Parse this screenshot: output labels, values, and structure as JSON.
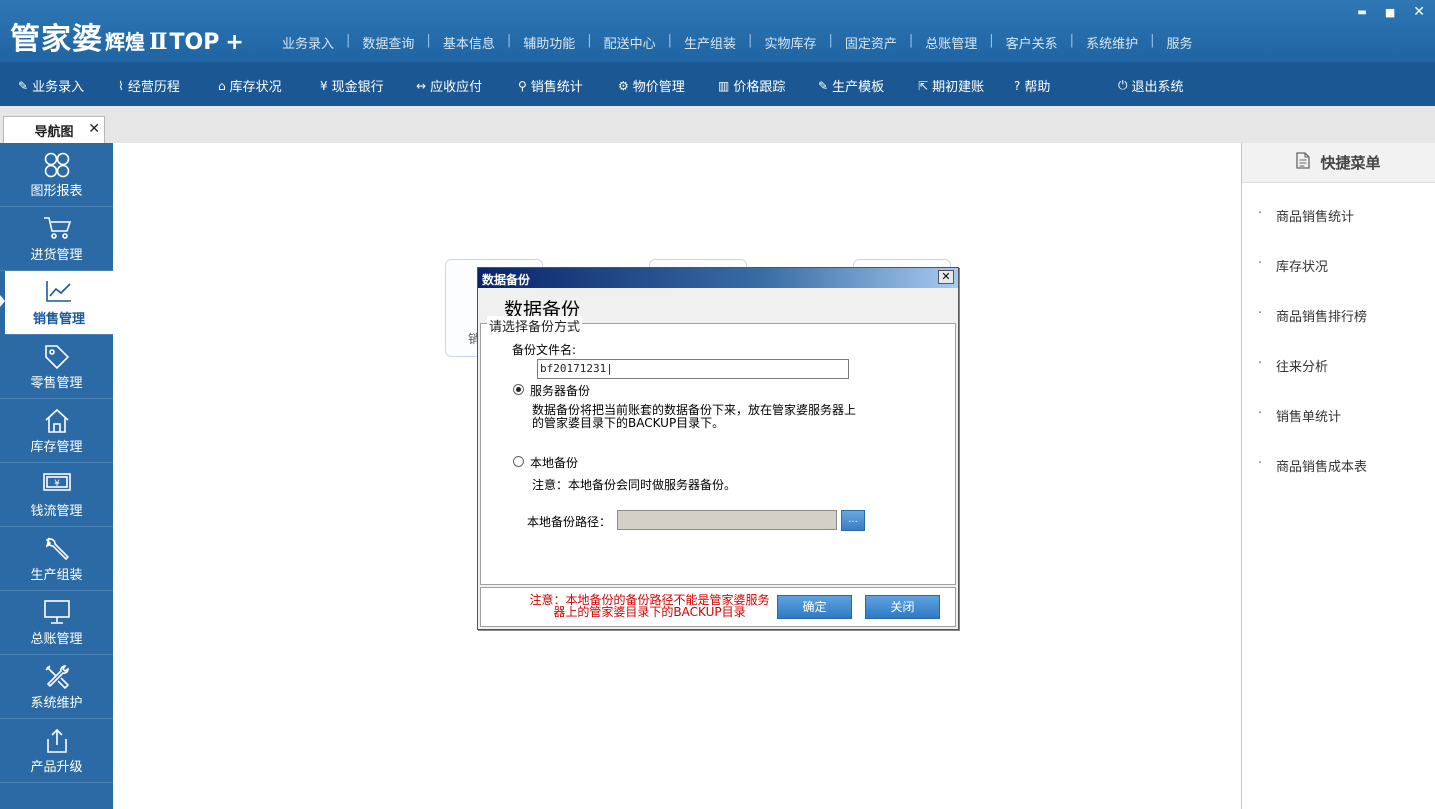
{
  "app": {
    "logo_main": "管家婆",
    "logo_sub": "辉煌",
    "logo_ver": "Ⅱ",
    "logo_top": "TOP",
    "logo_plus": "+"
  },
  "window_controls": {
    "minimize": "▬",
    "maximize": "■",
    "close": "✕"
  },
  "top_menu": [
    "业务录入",
    "数据查询",
    "基本信息",
    "辅助功能",
    "配送中心",
    "生产组装",
    "实物库存",
    "固定资产",
    "总账管理",
    "客户关系",
    "系统维护",
    "服务"
  ],
  "toolbar": [
    {
      "icon": "edit-icon",
      "glyph": "✎",
      "label": "业务录入"
    },
    {
      "icon": "chart-icon",
      "glyph": "⌇",
      "label": "经营历程"
    },
    {
      "icon": "home-icon",
      "glyph": "⌂",
      "label": "库存状况"
    },
    {
      "icon": "yen-icon",
      "glyph": "¥",
      "label": "现金银行"
    },
    {
      "icon": "exchange-icon",
      "glyph": "↔",
      "label": "应收应付"
    },
    {
      "icon": "search-icon",
      "glyph": "⚲",
      "label": "销售统计"
    },
    {
      "icon": "gear-icon",
      "glyph": "⚙",
      "label": "物价管理"
    },
    {
      "icon": "bar-chart-icon",
      "glyph": "▥",
      "label": "价格跟踪"
    },
    {
      "icon": "wrench-icon",
      "glyph": "✎",
      "label": "生产模板"
    },
    {
      "icon": "external-icon",
      "glyph": "⇱",
      "label": "期初建账"
    },
    {
      "icon": "help-icon",
      "glyph": "?",
      "label": "帮助"
    },
    {
      "icon": "power-icon",
      "glyph": "⏻",
      "label": "退出系统"
    }
  ],
  "tab": {
    "label": "导航图",
    "close": "✕"
  },
  "sidebar": [
    {
      "icon": "grid-icon",
      "label": "图形报表"
    },
    {
      "icon": "cart-icon",
      "label": "进货管理"
    },
    {
      "icon": "trend-icon",
      "label": "销售管理"
    },
    {
      "icon": "tag-icon",
      "label": "零售管理"
    },
    {
      "icon": "house-icon",
      "label": "库存管理"
    },
    {
      "icon": "money-icon",
      "label": "钱流管理"
    },
    {
      "icon": "wrench-icon",
      "label": "生产组装"
    },
    {
      "icon": "monitor-icon",
      "label": "总账管理"
    },
    {
      "icon": "tools-icon",
      "label": "系统维护"
    },
    {
      "icon": "upload-icon",
      "label": "产品升级"
    }
  ],
  "main": {
    "card_fragment": "销"
  },
  "quick_menu": {
    "title": "快捷菜单",
    "items": [
      "商品销售统计",
      "库存状况",
      "商品销售排行榜",
      "往来分析",
      "销售单统计",
      "商品销售成本表"
    ]
  },
  "dialog": {
    "title": "数据备份",
    "close": "✕",
    "heading": "数据备份",
    "group_label": "请选择备份方式",
    "filename_label": "备份文件名:",
    "filename_value": "bf20171231|",
    "server_option": "服务器备份",
    "server_desc_1": "数据备份将把当前账套的数据备份下来，放在管家婆服务器上",
    "server_desc_2": "的管家婆目录下的BACKUP目录下。",
    "local_option": "本地备份",
    "local_note": "注意：本地备份会同时做服务器备份。",
    "local_path_label": "本地备份路径：",
    "browse_label": "...",
    "warning_1": "注意：本地备份的备份路径不能是管家婆服务",
    "warning_2": "器上的管家婆目录下的BACKUP目录",
    "ok_label": "确定",
    "close_label": "关闭"
  }
}
